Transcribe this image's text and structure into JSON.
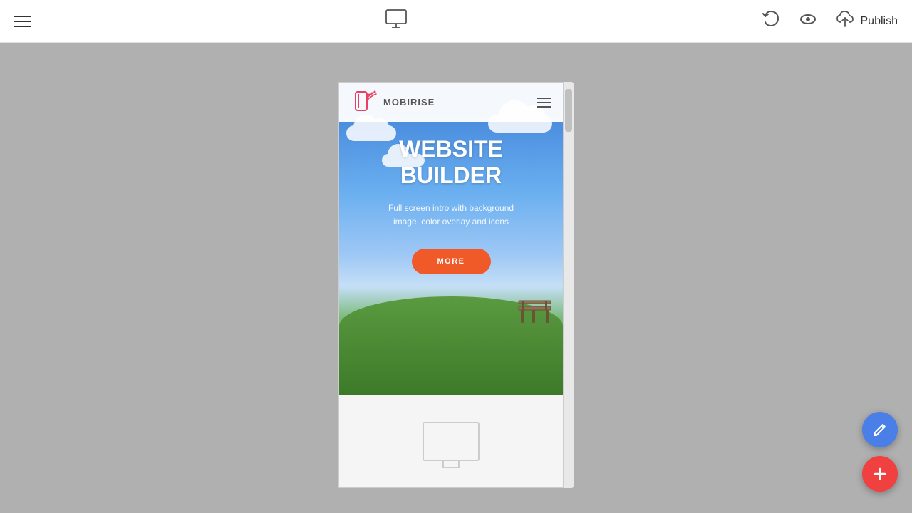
{
  "toolbar": {
    "publish_label": "Publish",
    "hamburger_label": "Menu"
  },
  "preview": {
    "navbar": {
      "logo_text": "MOBIRISE",
      "hamburger_label": "Menu"
    },
    "hero": {
      "title_line1": "WEBSITE",
      "title_line2": "BUILDER",
      "subtitle": "Full screen intro with background image, color overlay and icons",
      "cta_label": "MORE"
    }
  },
  "fabs": {
    "edit_label": "✎",
    "add_label": "+"
  },
  "icons": {
    "monitor": "monitor-icon",
    "undo": "undo-icon",
    "eye": "eye-icon",
    "publish_cloud": "cloud-upload-icon"
  },
  "colors": {
    "accent_red": "#f05a28",
    "fab_blue": "#4a7fe8",
    "fab_red": "#f04040",
    "toolbar_bg": "#ffffff",
    "canvas_bg": "#b0b0b0"
  }
}
